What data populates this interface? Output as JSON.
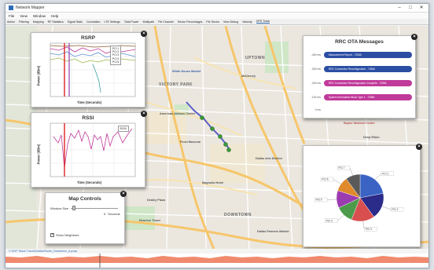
{
  "window": {
    "title": "Network Mapper"
  },
  "menu": [
    "File",
    "View",
    "Window",
    "Help"
  ],
  "toolbar": [
    "Action",
    "Filtering",
    "Mapping",
    "RF Statistics",
    "Signal Stats",
    "Correlation",
    "LTE Settings",
    "Total Power",
    "Multipath",
    "Pie Channel",
    "Sector Percentages",
    "Pie Sector",
    "View Debug",
    "Velocity",
    "GPS Track"
  ],
  "map": {
    "labels": {
      "whitehouse": "White House Market",
      "victory_park": "VICTORY PARK",
      "uptown": "UPTOWN",
      "downtown": "DOWNTOWN",
      "american_airlines": "American Airlines Center",
      "perot": "Perot Museum",
      "arts": "Dallas Arts District",
      "magnolia": "Magnolia Hotel",
      "mckinney": "McKinney",
      "dealey": "Dealey Plaza",
      "baylor": "Baylor Medical Center",
      "deep_ellum": "Deep Ellum",
      "farmers": "Dallas Farmers Market",
      "reunion": "Reunion Tower"
    }
  },
  "rsrp": {
    "title": "RSRP",
    "ylabel": "Power (dBm)",
    "xlabel": "Time (Seconds)",
    "legend": [
      "PCI 1",
      "PCI 2",
      "PCI 3",
      "PCI 4",
      "PCI 5"
    ]
  },
  "rssi": {
    "title": "RSSI",
    "ylabel": "Power (dBm)",
    "xlabel": "Time (Seconds)",
    "legend": [
      "RSSI"
    ]
  },
  "ota": {
    "title": "RRC OTA Messages",
    "messages": [
      {
        "time": "-400 ms",
        "text": "Measurement Report - 72566",
        "color": "#2b4ea3"
      },
      {
        "time": "-300 ms",
        "text": "RRC Connection Reconfiguration - 72566",
        "color": "#2b4ea3"
      },
      {
        "time": "-200 ms",
        "text": "RRC Connection Reconfiguration Complete - 72566",
        "color": "#c03a9a"
      },
      {
        "time": "-100 ms",
        "text": "System Information Block Type 1 - 72566",
        "color": "#c03a9a"
      },
      {
        "time": "0 ms",
        "text": "",
        "color": ""
      }
    ]
  },
  "map_controls": {
    "title": "Map Controls",
    "window_size_label": "Window Size",
    "window_value": "5",
    "window_unit": "Seconds",
    "show_neighbors_label": "Show Neighbors",
    "show_neighbors_checked": true
  },
  "pie": {
    "chart_data": {
      "type": "pie",
      "categories": [
        "PCI 1",
        "PCI 2",
        "PCI 3",
        "PCI 4",
        "PCI 5",
        "PCI 6",
        "PCI 7"
      ],
      "values": [
        22,
        18,
        16,
        12,
        12,
        10,
        10
      ],
      "colors": [
        "#3a63c4",
        "#2b2b8a",
        "#d94f4f",
        "#4b9b4b",
        "#9b3bb0",
        "#e08a2b",
        "#5a5a5a"
      ],
      "legend": [
        "PCI 1",
        "PCI 2",
        "PCI 3",
        "PCI 4",
        "PCI 5",
        "PCI 6",
        "PCI 7"
      ]
    }
  },
  "status": {
    "link_text": "C:\\EXP Stack Traces\\Dallas\\Route_Downtown_A.pcap"
  }
}
